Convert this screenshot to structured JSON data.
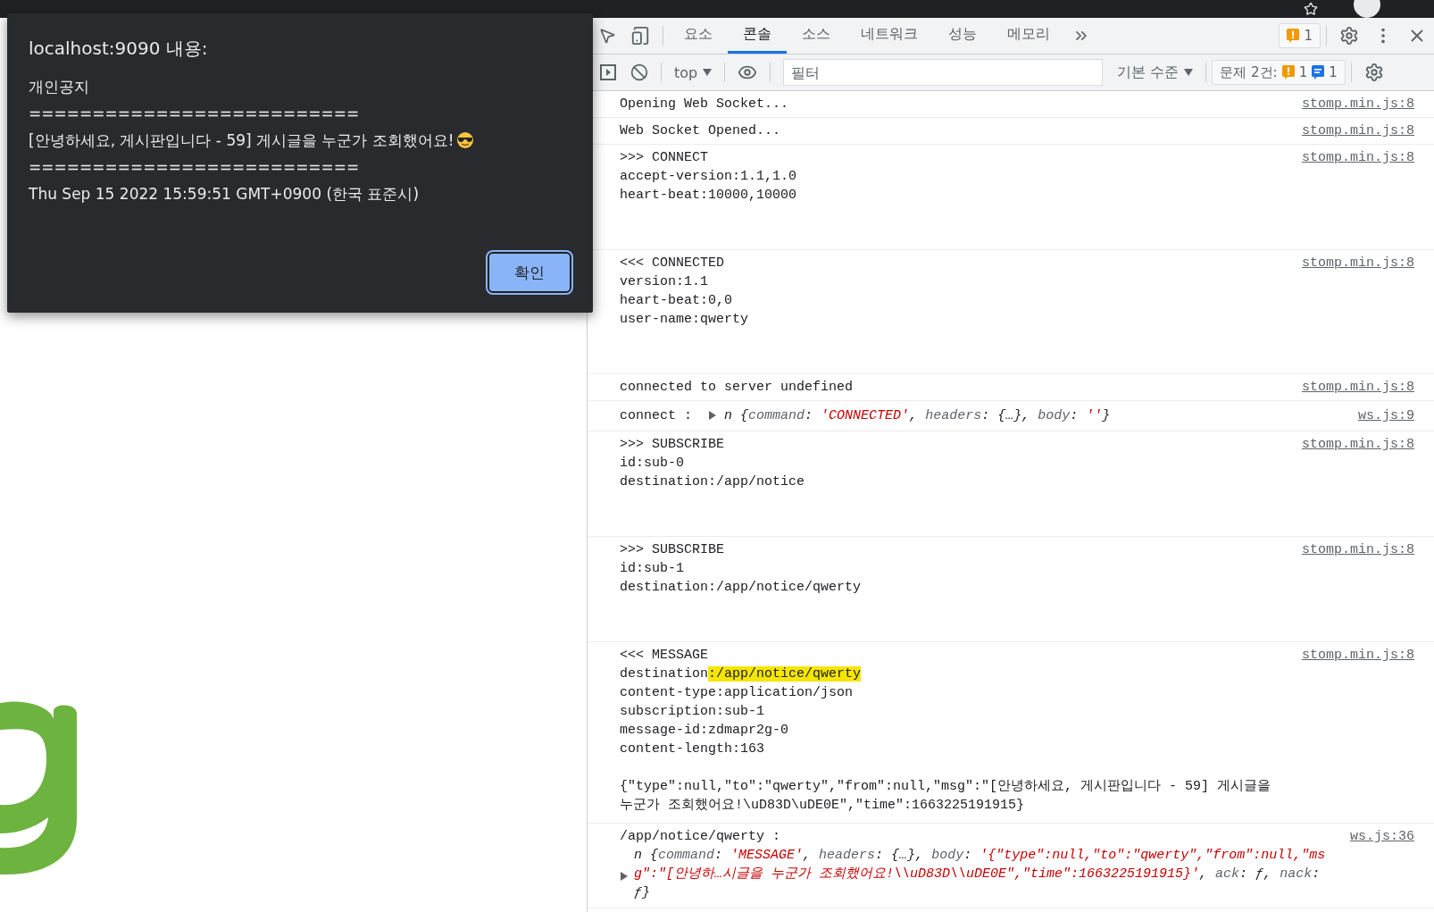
{
  "dialog": {
    "title": "localhost:9090 내용:",
    "lines": [
      "개인공지",
      "==========================",
      "[안녕하세요, 게시판입니다 - 59] 게시글을 누군가 조회했어요!",
      "==========================",
      "Thu Sep 15 2022 15:59:51 GMT+0900 (한국 표준시)"
    ],
    "button": "확인"
  },
  "devtools": {
    "tabs": [
      {
        "label": "요소",
        "selected": false
      },
      {
        "label": "콘솔",
        "selected": true
      },
      {
        "label": "소스",
        "selected": false
      },
      {
        "label": "네트워크",
        "selected": false
      },
      {
        "label": "성능",
        "selected": false
      },
      {
        "label": "메모리",
        "selected": false
      }
    ],
    "issues_badge": "1",
    "filter_bar": {
      "context": "top",
      "placeholder": "필터",
      "level": "기본 수준",
      "issues_label": "문제 2건:",
      "warnings": "1",
      "infos": "1"
    },
    "console": [
      {
        "kind": "text",
        "lines": [
          "Opening Web Socket..."
        ],
        "source": "stomp.min.js:8"
      },
      {
        "kind": "text",
        "lines": [
          "Web Socket Opened..."
        ],
        "source": "stomp.min.js:8"
      },
      {
        "kind": "frame",
        "lines": [
          ">>> CONNECT",
          "accept-version:1.1,1.0",
          "heart-beat:10000,10000"
        ],
        "source": "stomp.min.js:8"
      },
      {
        "kind": "frame",
        "lines": [
          "<<< CONNECTED",
          "version:1.1",
          "heart-beat:0,0",
          "user-name:qwerty"
        ],
        "source": "stomp.min.js:8"
      },
      {
        "kind": "text",
        "lines": [
          "connected to server undefined"
        ],
        "source": "stomp.min.js:8"
      },
      {
        "kind": "object",
        "label": "connect :",
        "expanded": false,
        "tokens": [
          {
            "t": "n",
            "kind": "name"
          },
          {
            "t": " {",
            "kind": "punct"
          },
          {
            "t": "command",
            "kind": "key"
          },
          {
            "t": ": ",
            "kind": "punct"
          },
          {
            "t": "'CONNECTED'",
            "kind": "string"
          },
          {
            "t": ", ",
            "kind": "punct"
          },
          {
            "t": "headers",
            "kind": "key"
          },
          {
            "t": ": {…}, ",
            "kind": "punct"
          },
          {
            "t": "body",
            "kind": "key"
          },
          {
            "t": ": ",
            "kind": "punct"
          },
          {
            "t": "''",
            "kind": "string"
          },
          {
            "t": "}",
            "kind": "punct"
          }
        ],
        "source": "ws.js:9"
      },
      {
        "kind": "frame",
        "lines": [
          ">>> SUBSCRIBE",
          "id:sub-0",
          "destination:/app/notice"
        ],
        "source": "stomp.min.js:8"
      },
      {
        "kind": "frame",
        "lines": [
          ">>> SUBSCRIBE",
          "id:sub-1",
          "destination:/app/notice/qwerty"
        ],
        "source": "stomp.min.js:8"
      },
      {
        "kind": "frame",
        "lines": [
          "<<< MESSAGE",
          {
            "text": "destination",
            "highlight": ":/app/notice/qwerty"
          },
          "content-type:application/json",
          "subscription:sub-1",
          "message-id:zdmapr2g-0",
          "content-length:163"
        ],
        "body": "{\"type\":null,\"to\":\"qwerty\",\"from\":null,\"msg\":\"[안녕하세요, 게시판입니다 - 59] 게시글을 누군가 조회했어요!\\uD83D\\uDE0E\",\"time\":1663225191915}",
        "source": "stomp.min.js:8"
      },
      {
        "kind": "object_wrapped",
        "label": "/app/notice/qwerty :",
        "expanded": false,
        "tokens": [
          {
            "t": "n",
            "kind": "name"
          },
          {
            "t": " {",
            "kind": "punct"
          },
          {
            "t": "command",
            "kind": "key"
          },
          {
            "t": ": ",
            "kind": "punct"
          },
          {
            "t": "'MESSAGE'",
            "kind": "string"
          },
          {
            "t": ", ",
            "kind": "punct"
          },
          {
            "t": "headers",
            "kind": "key"
          },
          {
            "t": ": {…}, ",
            "kind": "punct"
          },
          {
            "t": "body",
            "kind": "key"
          },
          {
            "t": ": ",
            "kind": "punct"
          },
          {
            "t": "'{\"type\":null,\"to\":\"qwerty\",\"from\":null,\"msg\":\"[안녕하…시글을 누군가 조회했어요!\\\\uD83D\\\\uDE0E\",\"time\":1663225191915}'",
            "kind": "string"
          },
          {
            "t": ", ",
            "kind": "punct"
          },
          {
            "t": "ack",
            "kind": "key"
          },
          {
            "t": ": ƒ, ",
            "kind": "punct"
          },
          {
            "t": "nack",
            "kind": "key"
          },
          {
            "t": ": ƒ}",
            "kind": "punct"
          }
        ],
        "source": "ws.js:36"
      }
    ]
  }
}
